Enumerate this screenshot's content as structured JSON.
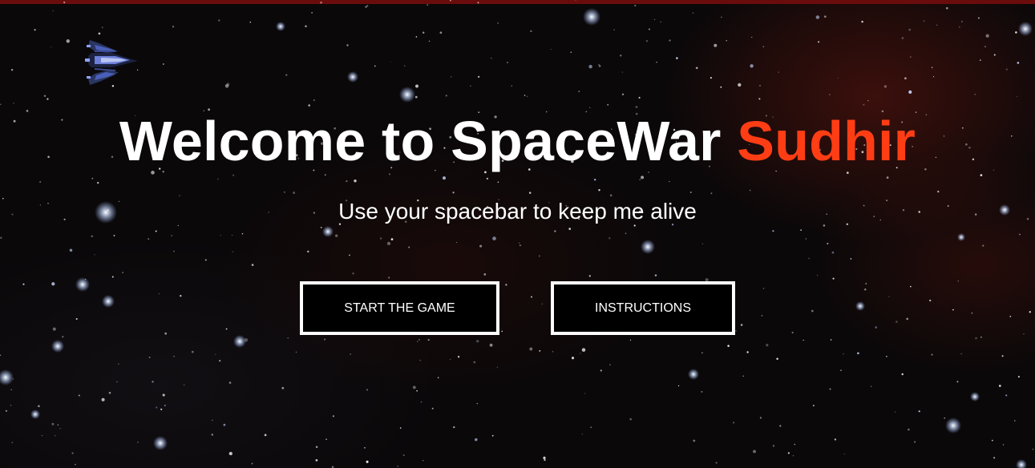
{
  "game": {
    "title_prefix": "Welcome to SpaceWar ",
    "player_name": "Sudhir",
    "subtitle": "Use your spacebar to keep me alive"
  },
  "buttons": {
    "start_label": "START THE GAME",
    "instructions_label": "INSTRUCTIONS"
  },
  "colors": {
    "accent": "#ff3d14",
    "top_bar": "#6b0c0c",
    "background": "#0a0809",
    "button_border": "#ffffff",
    "button_fill": "#000000"
  },
  "icons": {
    "player_ship": "spaceship-icon"
  }
}
